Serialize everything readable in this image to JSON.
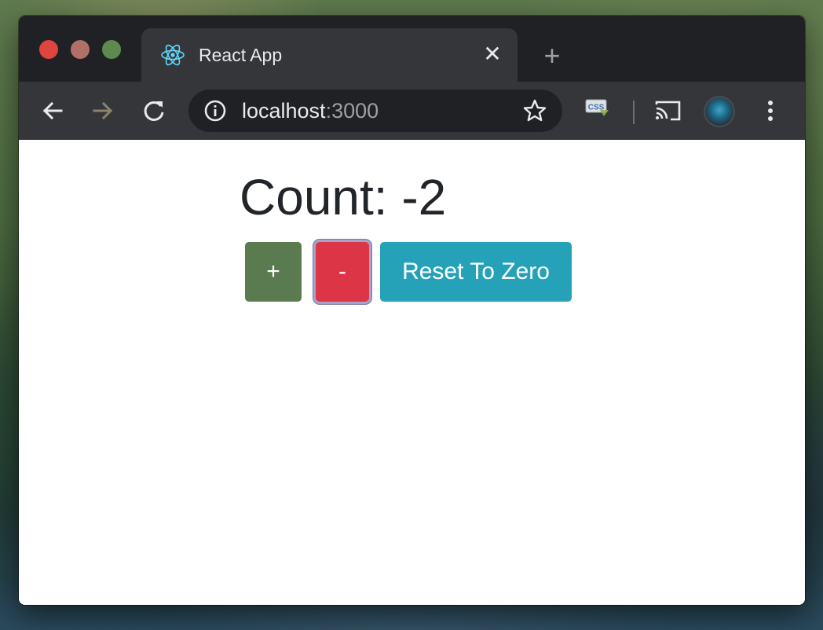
{
  "browser": {
    "tab": {
      "title": "React App",
      "favicon": "react-icon",
      "close_glyph": "✕"
    },
    "new_tab_glyph": "+",
    "toolbar": {
      "back_icon": "arrow-left-icon",
      "forward_icon": "arrow-right-icon",
      "reload_icon": "reload-icon",
      "url_host": "localhost",
      "url_port": ":3000",
      "bookmark_icon": "star-icon",
      "extension_icon": "css-icon",
      "extension_label": "CSS",
      "cast_icon": "cast-icon",
      "profile_icon": "avatar",
      "menu_icon": "more-vert-icon"
    },
    "traffic_lights": {
      "close_color": "#e0443e",
      "minimize_color": "#b07068",
      "maximize_color": "#5f8a4f"
    }
  },
  "app": {
    "count_text": "Count: -2",
    "buttons": {
      "increment_label": "+",
      "decrement_label": "-",
      "reset_label": "Reset To Zero"
    }
  },
  "colors": {
    "increment": "#5a7a4f",
    "decrement": "#dc3545",
    "reset": "#26a2b8",
    "text": "#212529"
  }
}
